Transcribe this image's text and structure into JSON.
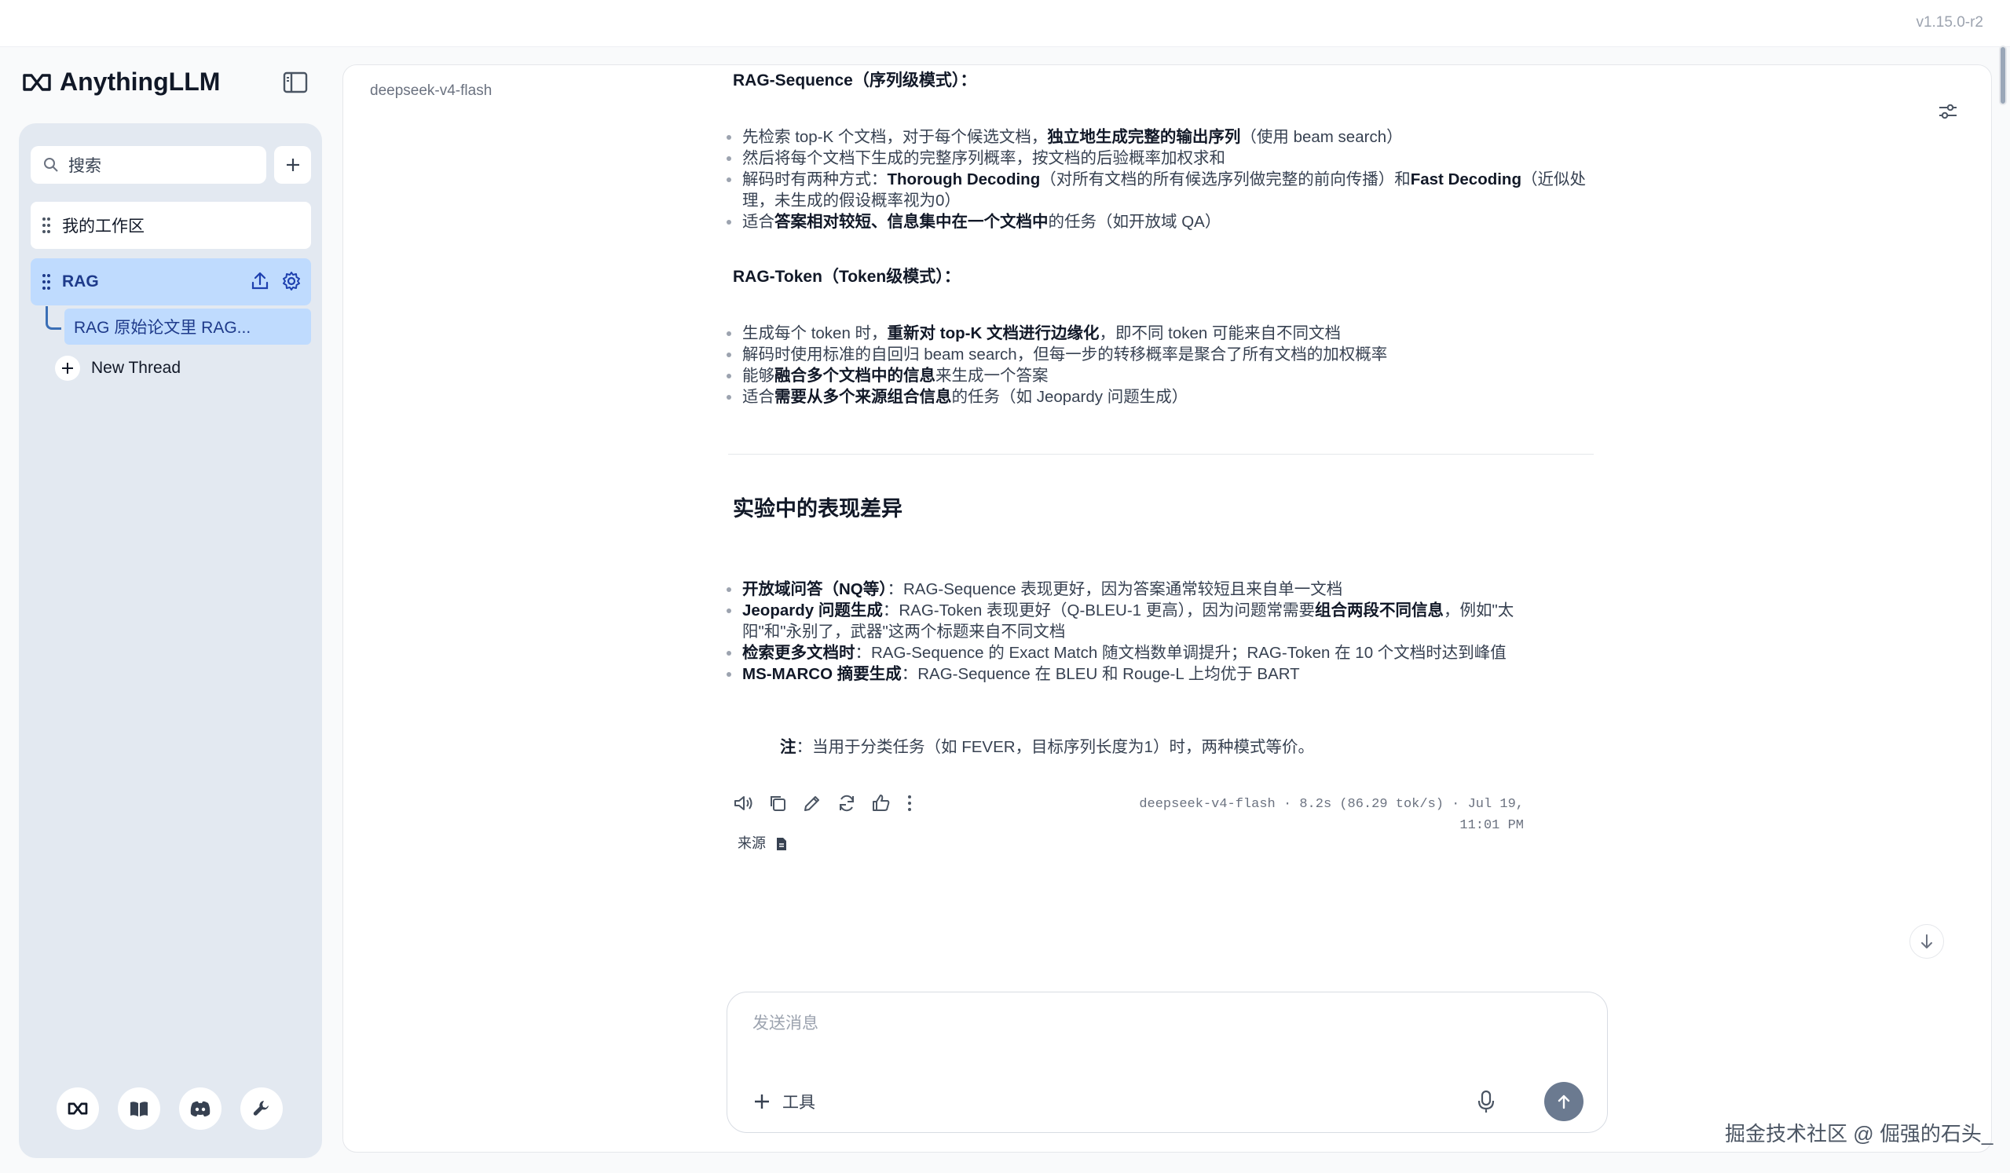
{
  "app": {
    "version": "v1.15.0-r2",
    "brand": "AnythingLLM"
  },
  "sidebar": {
    "search_placeholder": "搜索",
    "workspaces": [
      {
        "label": "我的工作区"
      },
      {
        "label": "RAG"
      }
    ],
    "thread": {
      "label": "RAG 原始论文里 RAG..."
    },
    "new_thread": "New Thread"
  },
  "main": {
    "model": "deepseek-v4-flash",
    "section1": {
      "title": "RAG-Sequence（序列级模式）：",
      "items": [
        [
          "先检索 top-K 个文档，对于每个候选文档，",
          "独立地生成完整的输出序列",
          "（使用 beam search）"
        ],
        [
          "然后将每个文档下生成的完整序列概率，按文档的后验概率加权求和",
          "",
          ""
        ],
        [
          "解码时有两种方式：",
          "Thorough Decoding",
          "（对所有文档的所有候选序列做完整的前向传播）和",
          "Fast Decoding",
          "（近似处理，未生成的假设概率视为0）"
        ],
        [
          "适合",
          "答案相对较短、信息集中在一个文档中",
          "的任务（如开放域 QA）"
        ]
      ]
    },
    "section2": {
      "title": "RAG-Token（Token级模式）：",
      "items": [
        [
          "生成每个 token 时，",
          "重新对 top-K 文档进行边缘化",
          "，即不同 token 可能来自不同文档"
        ],
        [
          "解码时使用标准的自回归 beam search，但每一步的转移概率是聚合了所有文档的加权概率",
          "",
          ""
        ],
        [
          "能够",
          "融合多个文档中的信息",
          "来生成一个答案"
        ],
        [
          "适合",
          "需要从多个来源组合信息",
          "的任务（如 Jeopardy 问题生成）"
        ]
      ]
    },
    "section3": {
      "title": "实验中的表现差异",
      "items": [
        [
          "",
          "开放域问答（NQ等）",
          "：RAG-Sequence 表现更好，因为答案通常较短且来自单一文档"
        ],
        [
          "",
          "Jeopardy 问题生成",
          "：RAG-Token 表现更好（Q-BLEU-1 更高），因为问题常需要",
          "组合两段不同信息",
          "，例如\"太阳\"和\"永别了，武器\"这两个标题来自不同文档"
        ],
        [
          "",
          "检索更多文档时",
          "：RAG-Sequence 的 Exact Match 随文档数单调提升；RAG-Token 在 10 个文档时达到峰值"
        ],
        [
          "",
          "MS-MARCO 摘要生成",
          "：RAG-Sequence 在 BLEU 和 Rouge-L 上均优于 BART"
        ]
      ]
    },
    "note": {
      "label": "注",
      "text": "：当用于分类任务（如 FEVER，目标序列长度为1）时，两种模式等价。"
    },
    "meta": "deepseek-v4-flash · 8.2s (86.29 tok/s) · Jul 19, 11:01 PM",
    "sources_label": "来源",
    "composer": {
      "placeholder": "发送消息",
      "tools_label": "工具"
    }
  },
  "watermark": "掘金技术社区 @ 倔强的石头_",
  "colors": {
    "accent": "#bfdbfe",
    "sidebar_bg": "#e3e9f1",
    "send": "#6b7a90"
  }
}
